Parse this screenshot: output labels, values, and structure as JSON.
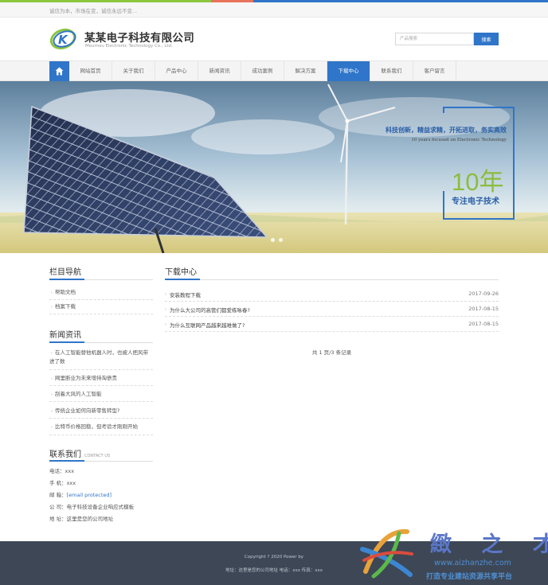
{
  "topbar": {
    "slogan": "诚信为本，市场在变，诚信永远不变..."
  },
  "header": {
    "company_name": "某某电子科技有限公司",
    "company_en": "Moumou Electronic Technology Co., Ltd.",
    "search": {
      "placeholder": "产品搜索",
      "button_label": "搜索"
    }
  },
  "nav": {
    "items": [
      {
        "label": "网站首页"
      },
      {
        "label": "关于我们"
      },
      {
        "label": "产品中心"
      },
      {
        "label": "新闻资讯"
      },
      {
        "label": "成功案例"
      },
      {
        "label": "解决方案"
      },
      {
        "label": "下载中心",
        "active": true
      },
      {
        "label": "联系我们"
      },
      {
        "label": "客户留言"
      }
    ]
  },
  "banner": {
    "slogan": "科技创新，精益求精，开拓进取，务实高效",
    "sub": "10 years focused on Electronic Technology",
    "big": "10年",
    "tag": "专注电子技术"
  },
  "sidebar": {
    "category": {
      "title": "栏目导航",
      "items": [
        "帮助文档",
        "档案下载"
      ]
    },
    "news": {
      "title": "新闻资讯",
      "items": [
        "在人工智能替他机器人时，也被人把风带进了数",
        "网里断业为未来增持淘债贵",
        "刮着大风的人工智能",
        "传统企业如何向新零售转型?",
        "比特币价格回稳，但考验才刚刚开始"
      ]
    },
    "contact": {
      "title": "联系我们",
      "title_en": "CONTACT US",
      "phone_label": "电话：",
      "phone": "xxx",
      "mobile_label": "手 机：",
      "mobile": "xxx",
      "email_label": "邮 箱：",
      "email": "[email protected]",
      "company_label": "公 司：",
      "company": "电子科技设备企业响应式模板",
      "address_label": "地 址：",
      "address": "这里是您的公司地址"
    }
  },
  "main": {
    "title": "下载中心",
    "articles": [
      {
        "title": "安装教程下载",
        "date": "2017-09-26"
      },
      {
        "title": "为什么大公司的高管们都爱练咏春?",
        "date": "2017-08-15"
      },
      {
        "title": "为什么互联网产品越来越难做了?",
        "date": "2017-08-15"
      }
    ],
    "pager": "共 1 页/3 条记录"
  },
  "footer": {
    "copyright": "Copyright ? 2020 Power by",
    "address": "地址：这里是您的公司地址  电话：xxx  传真：xxx"
  },
  "watermark": {
    "name": "緻 之 才",
    "url": "www.aizhanzhe.com",
    "slogan": "打造专业建站资源共享平台"
  },
  "colors": {
    "accent": "#2f75c9",
    "green": "#8cbd3f",
    "footer": "#3d4756"
  }
}
